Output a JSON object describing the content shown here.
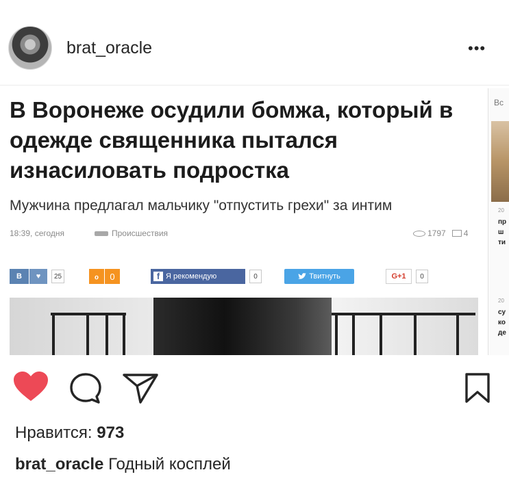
{
  "post": {
    "username": "brat_oracle",
    "more_label": "•••"
  },
  "article": {
    "headline": "В Воронеже осудили бомжа, который в одежде священника пытался изнасиловать подростка",
    "subheadline": "Мужчина предлагал мальчику \"отпустить грехи\" за интим",
    "time": "18:39, сегодня",
    "category": "Происшествия",
    "views": "1797",
    "comments": "4",
    "share": {
      "vk_label": "В",
      "vk_count": "25",
      "ok_count": "0",
      "fb_label": "Я рекомендую",
      "fb_count": "0",
      "tw_label": "Твитнуть",
      "gplus_label": "G+1",
      "gplus_count": "0"
    },
    "sidebar": {
      "top_text": "Вс",
      "item1_date": "20",
      "item1_text": "пр\nш\nти",
      "item2_date": "20",
      "item2_text": "су\nко\nде"
    }
  },
  "actions": {
    "liked": true,
    "like_color": "#ed4956",
    "icons": [
      "heart-icon",
      "comment-icon",
      "share-icon",
      "bookmark-icon"
    ]
  },
  "likes": {
    "label": "Нравится:",
    "count": "973"
  },
  "caption": {
    "username": "brat_oracle",
    "text": "Годный косплей"
  }
}
